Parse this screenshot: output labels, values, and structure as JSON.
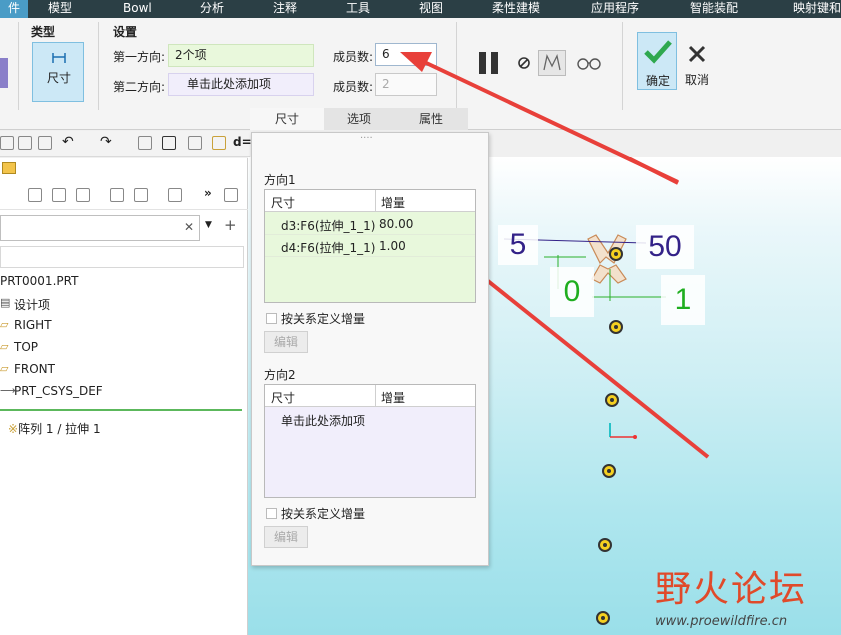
{
  "menubar": {
    "items": [
      "件",
      "模型",
      "Bowl",
      "分析",
      "注释",
      "工具",
      "视图",
      "柔性建模",
      "应用程序",
      "智能装配",
      "映射键和"
    ]
  },
  "ribbon": {
    "type_group": {
      "title": "类型",
      "button_label": "尺寸"
    },
    "settings_group": {
      "title": "设置",
      "dir1_label": "第一方向:",
      "dir1_value": "2个项",
      "dir2_label": "第二方向:",
      "dir2_value": "单击此处添加项",
      "members1_label": "成员数:",
      "members1_value": "6",
      "members2_label": "成员数:",
      "members2_value": "2"
    },
    "ok_label": "确定",
    "cancel_label": "取消",
    "tabs": [
      "尺寸",
      "选项",
      "属性"
    ]
  },
  "toolbar": {
    "partial_text": "d="
  },
  "tree": {
    "root": "PRT0001.PRT",
    "items": [
      "设计项",
      "RIGHT",
      "TOP",
      "FRONT",
      "PRT_CSYS_DEF"
    ],
    "pattern": "阵列 1 / 拉伸 1"
  },
  "dim_panel": {
    "dir1_title": "方向1",
    "dir2_title": "方向2",
    "col_dim": "尺寸",
    "col_inc": "增量",
    "dir1_rows": [
      {
        "dim": "d3:F6(拉伸_1_1)",
        "inc": "80.00"
      },
      {
        "dim": "d4:F6(拉伸_1_1)",
        "inc": "1.00"
      }
    ],
    "dir2_placeholder": "单击此处添加项",
    "relation_checkbox": "按关系定义增量",
    "edit_button": "编辑"
  },
  "graphics": {
    "dims": [
      "5",
      "50",
      "0",
      "1"
    ]
  },
  "watermark": {
    "title": "野火论坛",
    "url": "www.proewildfire.cn"
  },
  "colors": {
    "menubar_bg": "#2b3f45",
    "active_menu": "#4a9cc6",
    "dir1_table_bg": "#e8f8dc",
    "dir2_table_bg": "#f1eefb",
    "arrow_red": "#e8403a",
    "ok_green": "#2fa84f"
  }
}
